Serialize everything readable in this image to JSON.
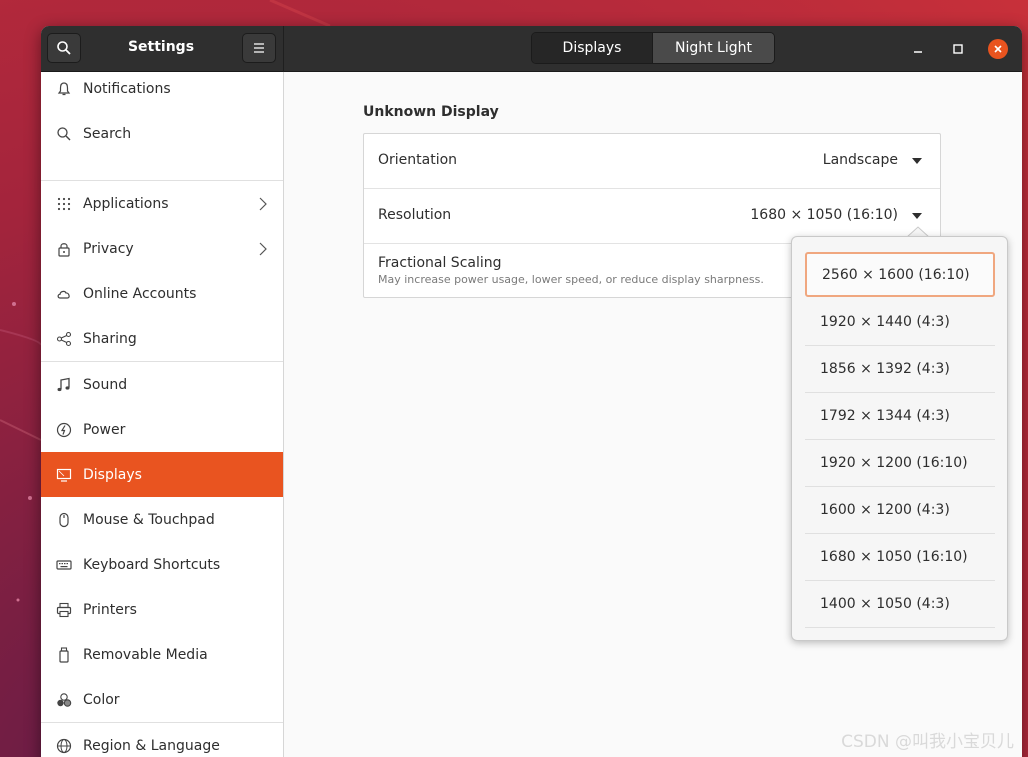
{
  "header": {
    "app_title": "Settings",
    "tabs": [
      {
        "label": "Displays",
        "active": true
      },
      {
        "label": "Night Light",
        "active": false
      }
    ]
  },
  "sidebar": {
    "items": [
      {
        "label": "Notifications",
        "icon": "bell-icon"
      },
      {
        "label": "Search",
        "icon": "search-icon"
      },
      {
        "label": "Applications",
        "icon": "grid-icon",
        "has_submenu": true
      },
      {
        "label": "Privacy",
        "icon": "lock-icon",
        "has_submenu": true
      },
      {
        "label": "Online Accounts",
        "icon": "cloud-icon"
      },
      {
        "label": "Sharing",
        "icon": "share-icon"
      },
      {
        "label": "Sound",
        "icon": "music-note-icon"
      },
      {
        "label": "Power",
        "icon": "power-icon"
      },
      {
        "label": "Displays",
        "icon": "display-icon",
        "selected": true
      },
      {
        "label": "Mouse & Touchpad",
        "icon": "mouse-icon"
      },
      {
        "label": "Keyboard Shortcuts",
        "icon": "keyboard-icon"
      },
      {
        "label": "Printers",
        "icon": "printer-icon"
      },
      {
        "label": "Removable Media",
        "icon": "removable-media-icon"
      },
      {
        "label": "Color",
        "icon": "color-icon"
      },
      {
        "label": "Region & Language",
        "icon": "globe-icon"
      }
    ]
  },
  "main": {
    "section_title": "Unknown Display",
    "orientation": {
      "label": "Orientation",
      "value": "Landscape"
    },
    "resolution": {
      "label": "Resolution",
      "value": "1680 × 1050 (16:10)"
    },
    "fractional_scaling": {
      "label": "Fractional Scaling",
      "description": "May increase power usage, lower speed, or reduce display sharpness."
    }
  },
  "resolution_popover": {
    "options": [
      "2560 × 1600 (16:10)",
      "1920 × 1440 (4:3)",
      "1856 × 1392 (4:3)",
      "1792 × 1344 (4:3)",
      "1920 × 1200 (16:10)",
      "1600 × 1200 (4:3)",
      "1680 × 1050 (16:10)",
      "1400 × 1050 (4:3)"
    ],
    "highlighted_index": 0
  },
  "watermark": "CSDN @叫我小宝贝儿",
  "colors": {
    "accent": "#e95420",
    "headerbar": "#2f2f2f",
    "sidebar_bg": "#ffffff",
    "content_bg": "#fafafa"
  }
}
